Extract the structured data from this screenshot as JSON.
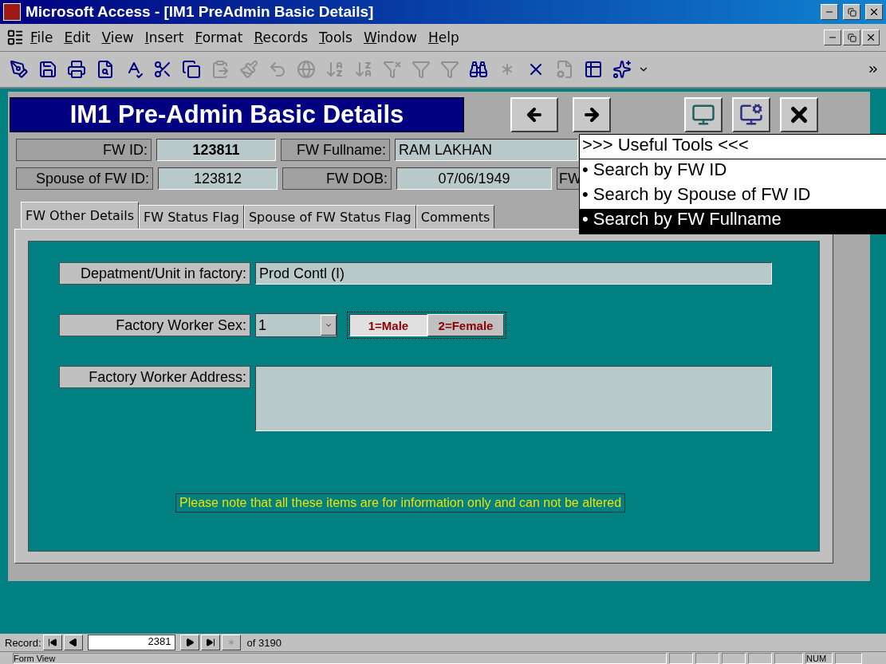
{
  "window": {
    "title": "Microsoft Access - [IM1 PreAdmin Basic Details]"
  },
  "menu": [
    {
      "label": "File"
    },
    {
      "label": "Edit"
    },
    {
      "label": "View"
    },
    {
      "label": "Insert"
    },
    {
      "label": "Format"
    },
    {
      "label": "Records"
    },
    {
      "label": "Tools"
    },
    {
      "label": "Window"
    },
    {
      "label": "Help"
    }
  ],
  "toolbar": [
    {
      "kind": "design",
      "disabled": false
    },
    {
      "kind": "save",
      "disabled": false
    },
    {
      "kind": "print",
      "disabled": false
    },
    {
      "kind": "preview",
      "disabled": false
    },
    {
      "kind": "spell",
      "disabled": false
    },
    {
      "kind": "cut",
      "disabled": false
    },
    {
      "kind": "copy",
      "disabled": false
    },
    {
      "kind": "paste",
      "disabled": true
    },
    {
      "kind": "painter",
      "disabled": true
    },
    {
      "kind": "undo",
      "disabled": true
    },
    {
      "kind": "link",
      "disabled": true
    },
    {
      "kind": "sort-asc",
      "disabled": true
    },
    {
      "kind": "sort-desc",
      "disabled": true
    },
    {
      "kind": "filter-selection",
      "disabled": true
    },
    {
      "kind": "filter-form",
      "disabled": true
    },
    {
      "kind": "filter",
      "disabled": true
    },
    {
      "kind": "find",
      "disabled": false
    },
    {
      "kind": "new-record",
      "disabled": true
    },
    {
      "kind": "delete-record",
      "disabled": false
    },
    {
      "kind": "properties",
      "disabled": true
    },
    {
      "kind": "database",
      "disabled": false
    },
    {
      "kind": "new-object",
      "disabled": false
    }
  ],
  "form": {
    "title": "IM1 Pre-Admin Basic Details",
    "fields_row_1": [
      {
        "label": "FW ID:",
        "value": "123811",
        "bold": true
      },
      {
        "label": "FW Fullname:",
        "value": "RAM LAKHAN"
      }
    ],
    "fields_row_2": [
      {
        "label": "Spouse of FW ID:",
        "value": "123812"
      },
      {
        "label": "FW DOB:",
        "value": "07/06/1949"
      },
      {
        "label": "FW"
      }
    ],
    "tabs": [
      {
        "label": "FW Other Details",
        "selected": true
      },
      {
        "label": "FW Status Flag",
        "selected": false
      },
      {
        "label": "Spouse of FW Status Flag",
        "selected": false
      },
      {
        "label": "Comments",
        "selected": false
      }
    ],
    "department": {
      "label": "Depatment/Unit in factory:",
      "value": "Prod Contl (I)"
    },
    "sex": {
      "label": "Factory Worker Sex:",
      "value": "1",
      "options": [
        {
          "label": "1=Male",
          "selected": true
        },
        {
          "label": "2=Female",
          "selected": false
        }
      ]
    },
    "address": {
      "label": "Factory Worker Address:"
    },
    "note": "Please note that all these items are for information only and can not be altered"
  },
  "tools_menu": {
    "header": ">>> Useful Tools <<<",
    "items": [
      {
        "label": "• Search by FW ID",
        "selected": false
      },
      {
        "label": "• Search by Spouse of FW ID",
        "selected": false
      },
      {
        "label": "• Search by FW Fullname",
        "selected": true
      }
    ]
  },
  "record_nav": {
    "label": "Record:",
    "current": "2381",
    "total": "of 3190"
  },
  "status_bar": {
    "text": "Form View",
    "indicator": "NUM"
  }
}
